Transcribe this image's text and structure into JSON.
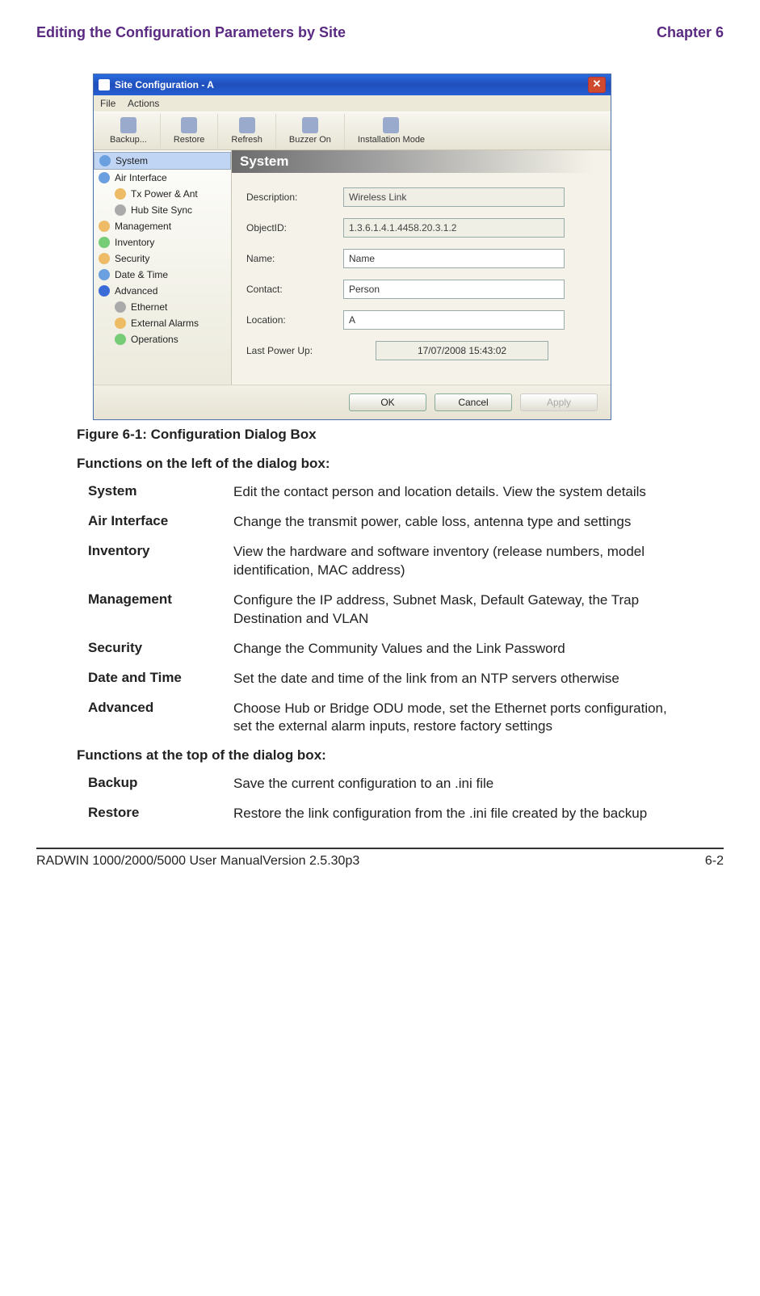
{
  "page_header": {
    "left": "Editing the Configuration Parameters by Site",
    "right": "Chapter 6"
  },
  "window": {
    "title": "Site Configuration - A",
    "menu": {
      "file": "File",
      "actions": "Actions"
    },
    "toolbar": {
      "backup": "Backup...",
      "restore": "Restore",
      "refresh": "Refresh",
      "buzzer": "Buzzer On",
      "install": "Installation Mode"
    },
    "side": {
      "system": "System",
      "air_interface": "Air Interface",
      "tx_power": "Tx Power & Ant",
      "hub_site": "Hub Site Sync",
      "management": "Management",
      "inventory": "Inventory",
      "security": "Security",
      "datetime": "Date & Time",
      "advanced": "Advanced",
      "ethernet": "Ethernet",
      "ext_alarms": "External Alarms",
      "operations": "Operations"
    },
    "panel_title": "System",
    "form": {
      "description_label": "Description:",
      "description_value": "Wireless Link",
      "objectid_label": "ObjectID:",
      "objectid_value": "1.3.6.1.4.1.4458.20.3.1.2",
      "name_label": "Name:",
      "name_value": "Name",
      "contact_label": "Contact:",
      "contact_value": "Person",
      "location_label": "Location:",
      "location_value": "A",
      "last_power_label": "Last Power Up:",
      "last_power_value": "17/07/2008 15:43:02"
    },
    "buttons": {
      "ok": "OK",
      "cancel": "Cancel",
      "apply": "Apply"
    }
  },
  "figure_caption": "Figure 6-1: Configuration Dialog Box",
  "section_left_title": "Functions on the left of the dialog box:",
  "definitions_left": [
    {
      "term": "System",
      "desc": "Edit the contact person and location details. View the system details"
    },
    {
      "term": "Air Interface",
      "desc": "Change the transmit power, cable loss, antenna type and settings"
    },
    {
      "term": "Inventory",
      "desc": "View the hardware and software inventory (release numbers, model identification, MAC address)"
    },
    {
      "term": "Management",
      "desc": "Configure the IP address, Subnet Mask, Default Gateway, the Trap Destination and VLAN"
    },
    {
      "term": "Security",
      "desc": "Change the Community Values and the Link Password"
    },
    {
      "term": "Date and Time",
      "desc": "Set the date and time of the link from an NTP servers otherwise"
    },
    {
      "term": "Advanced",
      "desc": "Choose Hub or Bridge ODU mode, set the Ethernet ports configuration, set the external alarm inputs, restore factory settings"
    }
  ],
  "section_top_title": "Functions at the top of the dialog box:",
  "definitions_top": [
    {
      "term": "Backup",
      "desc": "Save the current configuration to an .ini file"
    },
    {
      "term": "Restore",
      "desc": "Restore the link configuration from the .ini file created by the backup"
    }
  ],
  "footer": {
    "left": "RADWIN 1000/2000/5000 User ManualVersion  2.5.30p3",
    "right": "6-2"
  }
}
